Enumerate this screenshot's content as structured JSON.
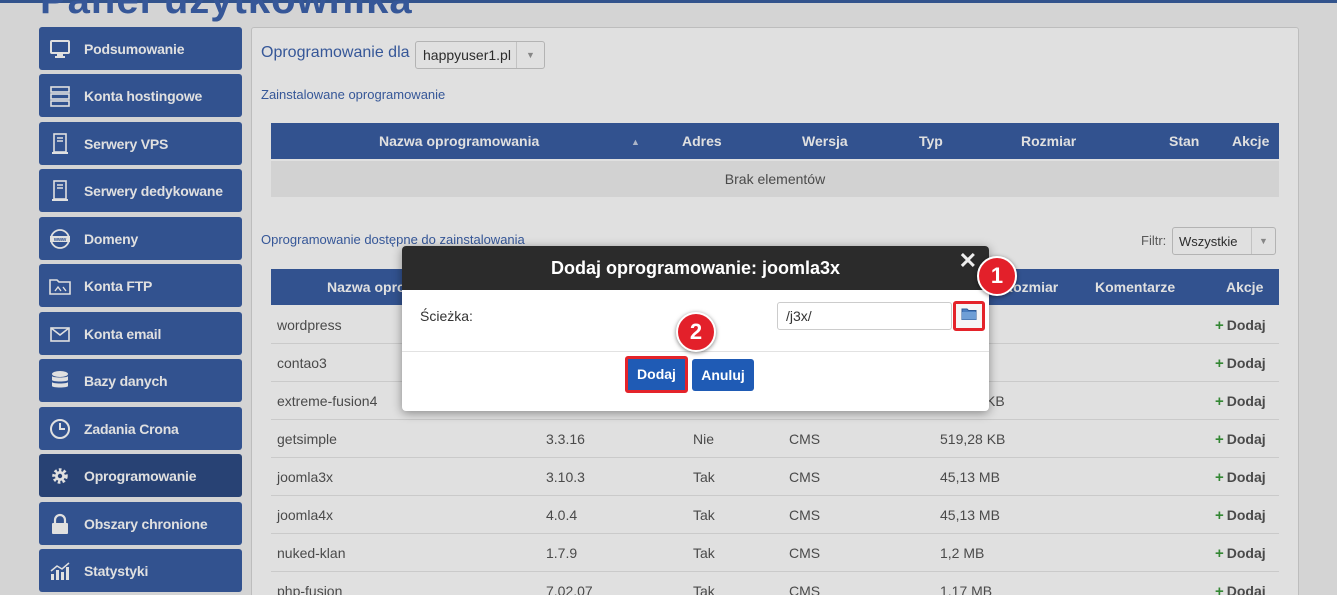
{
  "page": {
    "title_ghost": "Panel użytkownika"
  },
  "sidebar": {
    "items": [
      {
        "label": "Podsumowanie",
        "icon": "monitor-icon"
      },
      {
        "label": "Konta hostingowe",
        "icon": "server-stack-icon"
      },
      {
        "label": "Serwery VPS",
        "icon": "server-tower-icon"
      },
      {
        "label": "Serwery dedykowane",
        "icon": "server-tower-icon"
      },
      {
        "label": "Domeny",
        "icon": "globe-www-icon"
      },
      {
        "label": "Konta FTP",
        "icon": "ftp-folder-icon"
      },
      {
        "label": "Konta email",
        "icon": "envelope-icon"
      },
      {
        "label": "Bazy danych",
        "icon": "database-icon"
      },
      {
        "label": "Zadania Crona",
        "icon": "clock-icon"
      },
      {
        "label": "Oprogramowanie",
        "icon": "gear-icon",
        "active": true
      },
      {
        "label": "Obszary chronione",
        "icon": "lock-icon"
      },
      {
        "label": "Statystyki",
        "icon": "chart-icon"
      }
    ]
  },
  "main": {
    "software_for_label": "Oprogramowanie dla",
    "domain_select": "happyuser1.pl",
    "installed_label": "Zainstalowane oprogramowanie",
    "installed_headers": [
      "Nazwa oprogramowania",
      "Adres",
      "Wersja",
      "Typ",
      "Rozmiar",
      "Stan",
      "Akcje"
    ],
    "installed_empty": "Brak elementów",
    "available_label": "Oprogramowanie dostępne do zainstalowania",
    "filter_label": "Filtr:",
    "filter_value": "Wszystkie",
    "available_headers": {
      "name": "Nazwa oprogramowania",
      "size": "Rozmiar",
      "comments": "Komentarze",
      "actions": "Akcje"
    },
    "add_label": "Dodaj",
    "rows": [
      {
        "name": "wordpress",
        "version": "",
        "flag": "",
        "type": "",
        "size": ""
      },
      {
        "name": "contao3",
        "version": "",
        "flag": "",
        "type": "",
        "size": ""
      },
      {
        "name": "extreme-fusion4",
        "version": "",
        "flag": "",
        "type": "",
        "size": "KB"
      },
      {
        "name": "getsimple",
        "version": "3.3.16",
        "flag": "Nie",
        "type": "CMS",
        "size": "519,28 KB"
      },
      {
        "name": "joomla3x",
        "version": "3.10.3",
        "flag": "Tak",
        "type": "CMS",
        "size": "45,13 MB"
      },
      {
        "name": "joomla4x",
        "version": "4.0.4",
        "flag": "Tak",
        "type": "CMS",
        "size": "45,13 MB"
      },
      {
        "name": "nuked-klan",
        "version": "1.7.9",
        "flag": "Tak",
        "type": "CMS",
        "size": "1,2 MB"
      },
      {
        "name": "php-fusion",
        "version": "7.02.07",
        "flag": "Tak",
        "type": "CMS",
        "size": "1,17 MB"
      }
    ]
  },
  "modal": {
    "title": "Dodaj oprogramowanie: joomla3x",
    "close": "✕",
    "path_label": "Ścieżka:",
    "path_value": "/j3x/",
    "submit_label": "Dodaj",
    "cancel_label": "Anuluj",
    "folder_icon": "folder-icon"
  },
  "annotations": {
    "badge1": "1",
    "badge2": "2"
  },
  "colors": {
    "sidebar": "#3a5ea3",
    "accent_red": "#e3202a",
    "primary_button": "#1f5bb5"
  }
}
